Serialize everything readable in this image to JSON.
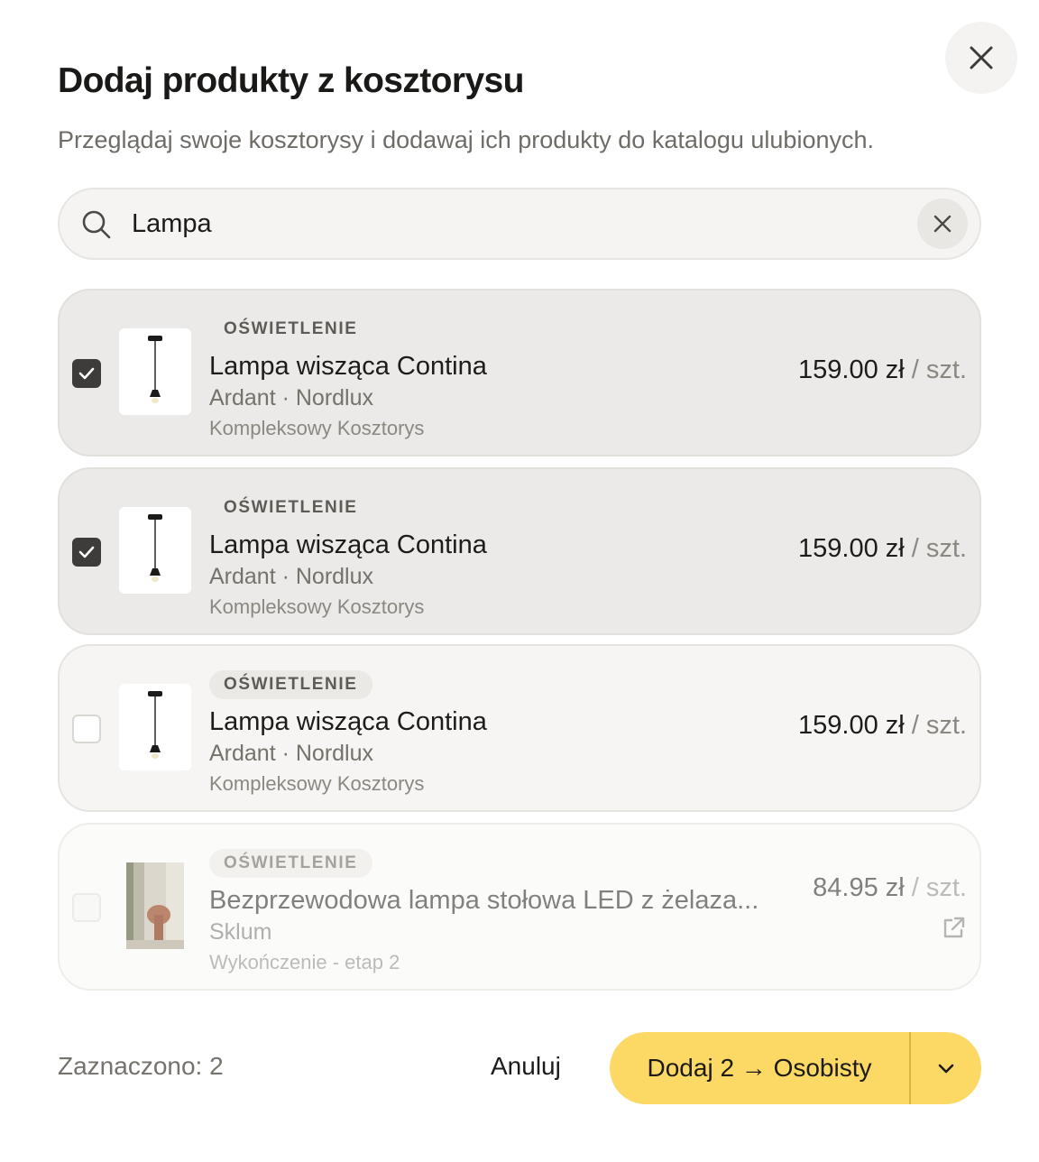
{
  "dialog": {
    "title": "Dodaj produkty z kosztorysu",
    "subtitle": "Przeglądaj swoje kosztorysy i dodawaj ich produkty do katalogu ulubionych."
  },
  "search": {
    "value": "Lampa"
  },
  "items": [
    {
      "category": "OŚWIETLENIE",
      "name": "Lampa wisząca Contina",
      "brand": "Ardant · Nordlux",
      "estimate": "Kompleksowy Kosztorys",
      "price": "159.00 zł",
      "unit": "/ szt.",
      "checked": true
    },
    {
      "category": "OŚWIETLENIE",
      "name": "Lampa wisząca Contina",
      "brand": "Ardant · Nordlux",
      "estimate": "Kompleksowy Kosztorys",
      "price": "159.00 zł",
      "unit": "/ szt.",
      "checked": true
    },
    {
      "category": "OŚWIETLENIE",
      "name": "Lampa wisząca Contina",
      "brand": "Ardant · Nordlux",
      "estimate": "Kompleksowy Kosztorys",
      "price": "159.00 zł",
      "unit": "/ szt.",
      "checked": false
    },
    {
      "category": "OŚWIETLENIE",
      "name": "Bezprzewodowa lampa stołowa LED z żelaza...",
      "brand": "Sklum",
      "estimate": "Wykończenie - etap 2",
      "price": "84.95 zł",
      "unit": "/ szt.",
      "checked": false,
      "disabled": true
    }
  ],
  "footer": {
    "selected_count": "Zaznaczono: 2",
    "cancel_label": "Anuluj",
    "add_label": "Dodaj 2 → Osobisty"
  },
  "icons": {
    "close": "close-icon",
    "search": "search-icon",
    "clear": "clear-icon",
    "check": "check-icon",
    "external": "external-link-icon",
    "dropdown": "chevron-down-icon"
  },
  "colors": {
    "accent": "#fcd965",
    "checkbox_checked": "#3d3c3a",
    "card_selected": "#ebeae8"
  }
}
